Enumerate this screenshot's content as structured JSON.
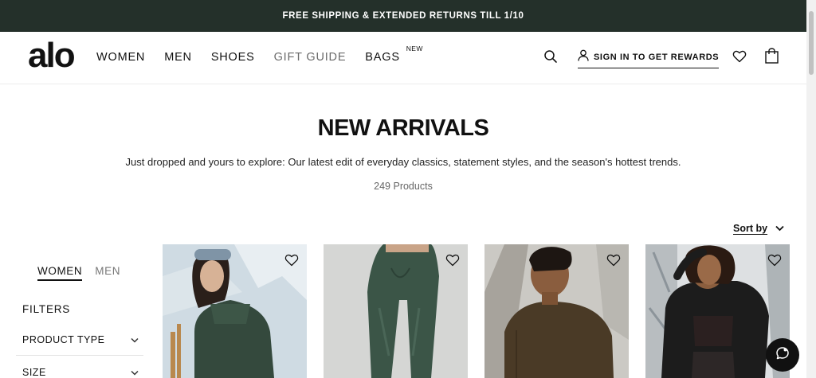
{
  "promo": {
    "text": "FREE SHIPPING & EXTENDED RETURNS TILL 1/10"
  },
  "header": {
    "logo": "alo",
    "nav": [
      {
        "label": "WOMEN"
      },
      {
        "label": "MEN"
      },
      {
        "label": "SHOES"
      },
      {
        "label": "GIFT GUIDE"
      },
      {
        "label": "BAGS",
        "badge": "NEW"
      }
    ],
    "signin": "SIGN IN TO GET REWARDS",
    "icons": [
      "search-icon",
      "user-icon",
      "heart-icon",
      "bag-icon"
    ]
  },
  "hero": {
    "title": "NEW ARRIVALS",
    "subtitle": "Just dropped and yours to explore: Our latest edit of everyday classics, statement styles, and the season's hottest trends.",
    "count": "249 Products"
  },
  "sort": {
    "label": "Sort by"
  },
  "sidebar": {
    "tabs": [
      {
        "label": "WOMEN",
        "active": true
      },
      {
        "label": "MEN",
        "active": false
      }
    ],
    "filters_title": "FILTERS",
    "filters": [
      {
        "label": "PRODUCT TYPE"
      },
      {
        "label": "SIZE"
      }
    ]
  },
  "colors": {
    "promo_bg": "#24302a",
    "text": "#111111",
    "forest_green": "#3a5244",
    "brown": "#4a3a26"
  }
}
